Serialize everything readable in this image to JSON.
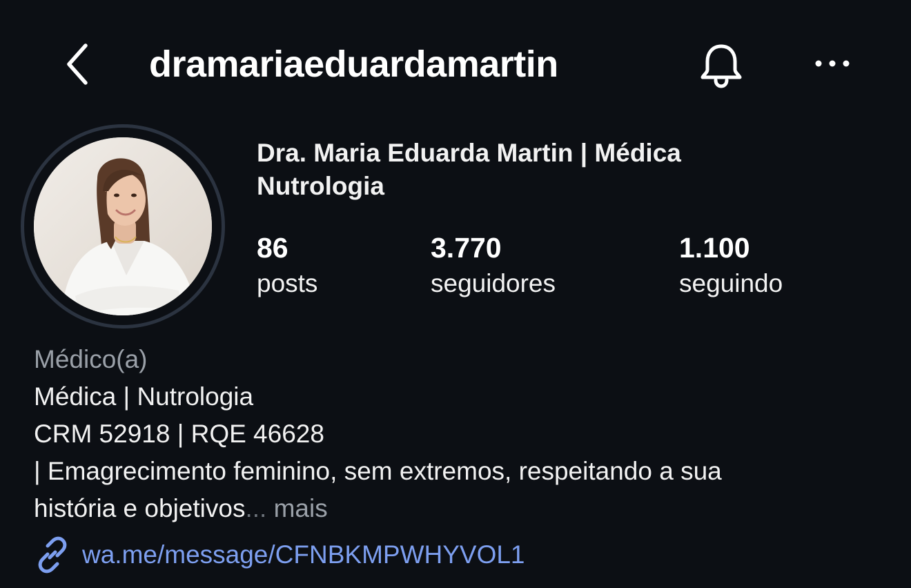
{
  "header": {
    "username": "dramariaeduardamartin",
    "back_icon": "chevron-left-icon",
    "notification_icon": "bell-icon",
    "more_icon": "more-horizontal-icon"
  },
  "profile": {
    "display_name": "Dra. Maria Eduarda Martin | Médica Nutrologia",
    "avatar": "profile-photo"
  },
  "stats": {
    "posts": {
      "value": "86",
      "label": "posts"
    },
    "followers": {
      "value": "3.770",
      "label": "seguidores"
    },
    "following": {
      "value": "1.100",
      "label": "seguindo"
    }
  },
  "bio": {
    "category": "Médico(a)",
    "line1": "Médica | Nutrologia",
    "line2": "CRM 52918 | RQE 46628",
    "line3": "| Emagrecimento feminino, sem extremos, respeitando a sua",
    "line4": "história e objetivos",
    "ellipsis": "...",
    "more": "mais"
  },
  "link": {
    "icon": "link-icon",
    "text": "wa.me/message/CFNBKMPWHYVOL1"
  },
  "colors": {
    "background": "#0c0f14",
    "text": "#f2f2f2",
    "muted": "#9aa0a8",
    "link": "#7d9ff0",
    "avatar_ring": "#2b3340"
  }
}
